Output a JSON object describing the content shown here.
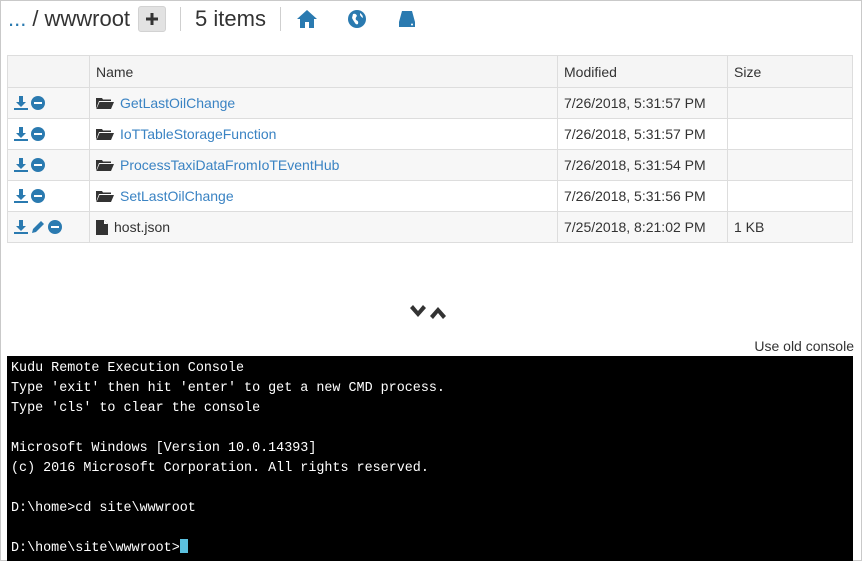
{
  "header": {
    "breadcrumb_ellipsis": "...",
    "breadcrumb_separator": "/",
    "current_folder": "wwwroot",
    "item_count": "5 items",
    "icons": [
      "plus-icon",
      "home-icon",
      "globe-icon",
      "drive-icon"
    ]
  },
  "table": {
    "columns": [
      "Name",
      "Modified",
      "Size"
    ],
    "rows": [
      {
        "name": "GetLastOilChange",
        "modified": "7/26/2018, 5:31:57 PM",
        "size": "",
        "type": "folder"
      },
      {
        "name": "IoTTableStorageFunction",
        "modified": "7/26/2018, 5:31:57 PM",
        "size": "",
        "type": "folder"
      },
      {
        "name": "ProcessTaxiDataFromIoTEventHub",
        "modified": "7/26/2018, 5:31:54 PM",
        "size": "",
        "type": "folder"
      },
      {
        "name": "SetLastOilChange",
        "modified": "7/26/2018, 5:31:56 PM",
        "size": "",
        "type": "folder"
      },
      {
        "name": "host.json",
        "modified": "7/25/2018, 8:21:02 PM",
        "size": "1 KB",
        "type": "file"
      }
    ]
  },
  "toggle_icons": [
    "chevron-down-icon",
    "chevron-up-icon"
  ],
  "old_console_link": "Use old console",
  "console": {
    "lines": [
      "Kudu Remote Execution Console",
      "Type 'exit' then hit 'enter' to get a new CMD process.",
      "Type 'cls' to clear the console",
      "",
      "Microsoft Windows [Version 10.0.14393]",
      "(c) 2016 Microsoft Corporation. All rights reserved.",
      "",
      "D:\\home>cd site\\wwwroot",
      "",
      "D:\\home\\site\\wwwroot>"
    ]
  },
  "colors": {
    "link": "#3a83c3",
    "icon_blue": "#2a7ab0",
    "console_bg": "#000000",
    "cursor": "#5bc0de"
  }
}
